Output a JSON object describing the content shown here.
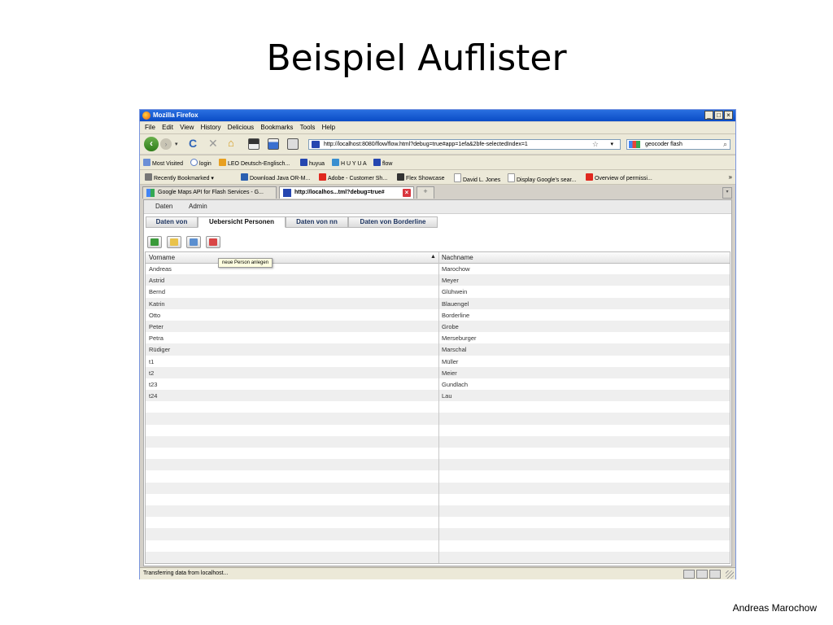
{
  "slide": {
    "title": "Beispiel Auflister",
    "author": "Andreas Marochow"
  },
  "window": {
    "title": "Mozilla Firefox",
    "min": "_",
    "max": "□",
    "close": "×"
  },
  "menu": [
    "File",
    "Edit",
    "View",
    "History",
    "Delicious",
    "Bookmarks",
    "Tools",
    "Help"
  ],
  "nav": {
    "back": "‹",
    "forward": "›",
    "dropdown": "▾",
    "reload": "C",
    "stop": "✕",
    "home": "⌂",
    "url": "http://localhost:8080/flow/flow.html?debug=true#app=1efa&2bfe-selectedIndex=1",
    "star": "☆",
    "search": "geocoder flash",
    "search_icon": "magnifier-icon"
  },
  "bookmarks_row1": [
    "Most Visited",
    "login",
    "LEO Deutsch-Englisch...",
    "huyua",
    "H U Y U A",
    "flow"
  ],
  "bookmarks_row2": [
    "Recently Bookmarked",
    "Download Java OR-M...",
    "Adobe - Customer Sh...",
    "Flex Showcase",
    "David L. Jones",
    "Display Google's sear...",
    "Overview of permissi..."
  ],
  "bookmarks_chevron": "»",
  "tabs": [
    {
      "label": "Google Maps API for Flash Services - G...",
      "active": false
    },
    {
      "label": "http://localhos...tml?debug=true#",
      "active": true
    }
  ],
  "newtab": "+",
  "tablist": "▾",
  "app": {
    "menu": [
      "Daten",
      "Admin"
    ],
    "subtabs": [
      "Daten von",
      "Uebersicht Personen",
      "Daten von nn",
      "Daten von Borderline"
    ],
    "selected_subtab": 1,
    "tooltip": "neue Person anlegen",
    "columns": [
      "Vorname",
      "Nachname"
    ],
    "sort_indicator": "▲",
    "rows": [
      {
        "vorname": "Andreas",
        "nachname": "Marochow"
      },
      {
        "vorname": "Astrid",
        "nachname": "Meyer"
      },
      {
        "vorname": "Bernd",
        "nachname": "Glühwein"
      },
      {
        "vorname": "Katrin",
        "nachname": "Blauengel"
      },
      {
        "vorname": "Otto",
        "nachname": "Borderline"
      },
      {
        "vorname": "Peter",
        "nachname": "Grobe"
      },
      {
        "vorname": "Petra",
        "nachname": "Merseburger"
      },
      {
        "vorname": "Rüdiger",
        "nachname": "Marschal"
      },
      {
        "vorname": "t1",
        "nachname": "Müller"
      },
      {
        "vorname": "t2",
        "nachname": "Meier"
      },
      {
        "vorname": "t23",
        "nachname": "Gundlach"
      },
      {
        "vorname": "t24",
        "nachname": "Lau"
      },
      {
        "vorname": "",
        "nachname": ""
      },
      {
        "vorname": "",
        "nachname": ""
      },
      {
        "vorname": "",
        "nachname": ""
      },
      {
        "vorname": "",
        "nachname": ""
      },
      {
        "vorname": "",
        "nachname": ""
      },
      {
        "vorname": "",
        "nachname": ""
      },
      {
        "vorname": "",
        "nachname": ""
      },
      {
        "vorname": "",
        "nachname": ""
      },
      {
        "vorname": "",
        "nachname": ""
      },
      {
        "vorname": "",
        "nachname": ""
      },
      {
        "vorname": "",
        "nachname": ""
      },
      {
        "vorname": "",
        "nachname": ""
      },
      {
        "vorname": "",
        "nachname": ""
      },
      {
        "vorname": "",
        "nachname": ""
      }
    ]
  },
  "status": "Transferring data from localhost..."
}
